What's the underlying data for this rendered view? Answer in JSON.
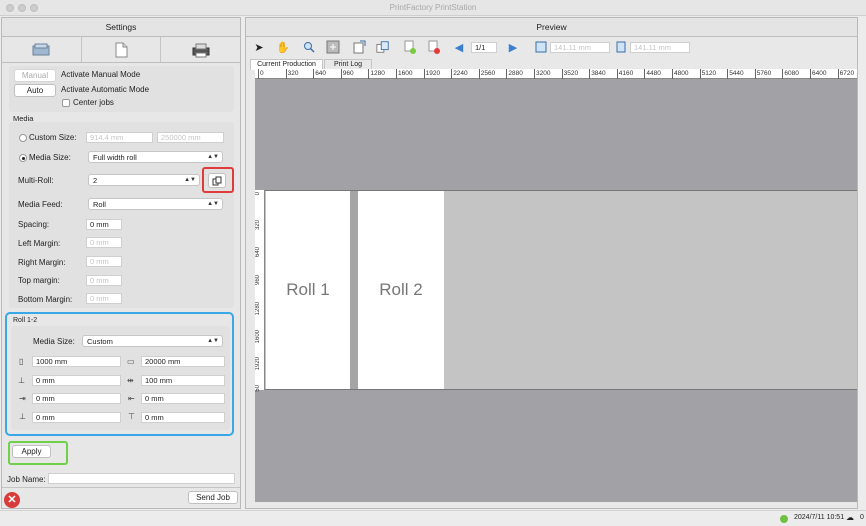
{
  "window": {
    "title": "PrintFactory PrintStation"
  },
  "settings": {
    "header": "Settings",
    "tabs": [
      "media-tab-icon",
      "document-tab-icon",
      "printer-tab-icon"
    ],
    "mode": {
      "manual_label": "Manual",
      "manual_desc": "Activate Manual Mode",
      "auto_label": "Auto",
      "auto_desc": "Activate Automatic Mode",
      "center_jobs": "Center jobs"
    },
    "media": {
      "section": "Media",
      "custom_size_label": "Custom Size:",
      "custom_w": "914.4 mm",
      "custom_h": "250000 mm",
      "media_size_label": "Media Size:",
      "media_size_value": "Full width roll",
      "multi_roll_label": "Multi-Roll:",
      "multi_roll_value": "2",
      "media_feed_label": "Media Feed:",
      "media_feed_value": "Roll",
      "spacing_label": "Spacing:",
      "spacing_value": "0 mm",
      "left_margin_label": "Left Margin:",
      "left_margin_value": "0 mm",
      "right_margin_label": "Right Margin:",
      "right_margin_value": "0 mm",
      "top_margin_label": "Top margin:",
      "top_margin_value": "0 mm",
      "bottom_margin_label": "Bottom Margin:",
      "bottom_margin_value": "0 mm"
    },
    "roll": {
      "title": "Roll 1-2",
      "media_size_label": "Media Size:",
      "media_size_value": "Custom",
      "width": "1000 mm",
      "length": "20000 mm",
      "f1": "0 mm",
      "f2": "100 mm",
      "f3": "0 mm",
      "f4": "0 mm",
      "f5": "0 mm",
      "f6": "0 mm"
    },
    "apply": "Apply",
    "job_name_label": "Job Name:",
    "job_name_value": "",
    "send_job": "Send Job"
  },
  "preview": {
    "header": "Preview",
    "page_value": "1/1",
    "width_value": "141.11 mm",
    "height_value": "141.11 mm",
    "tabs": [
      "Current Production",
      "Print Log"
    ],
    "ruler_top": [
      "0",
      "320",
      "640",
      "960",
      "1280",
      "1600",
      "1920",
      "2240",
      "2560",
      "2880",
      "3200",
      "3520",
      "3840",
      "4160",
      "4480",
      "4800",
      "5120",
      "5440",
      "5760",
      "6080",
      "6400",
      "6720"
    ],
    "ruler_left": [
      "0",
      "320",
      "640",
      "960",
      "1280",
      "1600",
      "1920",
      "50"
    ],
    "rolls": [
      "Roll 1",
      "Roll 2"
    ]
  },
  "status": {
    "datetime": "2024/7/11 10:51",
    "count": "0"
  },
  "colors": {
    "highlight_red": "#e03b3b",
    "highlight_blue": "#3aa7e6",
    "highlight_green": "#6fd04a",
    "canvas": "#a2a1a6"
  }
}
